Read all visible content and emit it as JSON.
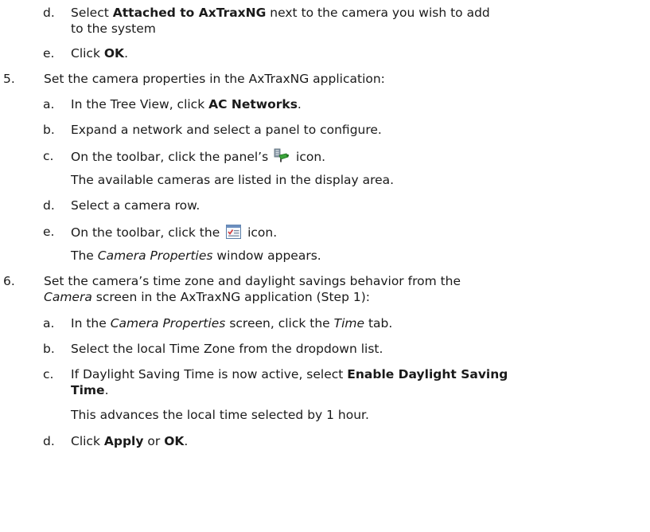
{
  "items": {
    "d1": {
      "label": "d.",
      "pre": "Select ",
      "bold": "Attached to AxTraxNG",
      "post": " next to the camera you wish to add",
      "line2": "to the system"
    },
    "e1": {
      "label": "e.",
      "pre": "Click ",
      "bold": "OK",
      "post": "."
    },
    "s5": {
      "label": "5.",
      "text": "Set the camera properties in the AxTraxNG application:"
    },
    "a5": {
      "label": "a.",
      "pre": "In the Tree View, click ",
      "bold": "AC Networks",
      "post": "."
    },
    "b5": {
      "label": "b.",
      "text": "Expand a network and select a panel to configure."
    },
    "c5": {
      "label": "c.",
      "pre": "On the toolbar, click the panel’s ",
      "post": " icon.",
      "note": "The available cameras are listed in the display area.",
      "icon": "camera-panel-icon"
    },
    "d5": {
      "label": "d.",
      "text": "Select a camera row."
    },
    "e5": {
      "label": "e.",
      "pre": "On the toolbar, click the ",
      "post": " icon.",
      "icon": "properties-icon",
      "note_italic": "Camera Properties",
      "note_post": " window appears.",
      "note_pre": "The "
    },
    "s6": {
      "label": "6.",
      "line1": "Set the camera’s time zone and daylight savings behavior from the",
      "line2_italic": "Camera",
      "line2_post": " screen in the AxTraxNG application (Step 1):"
    },
    "a6": {
      "label": "a.",
      "pre": "In the ",
      "italic1": "Camera Properties",
      "mid": " screen, click the ",
      "italic2": "Time",
      "post": " tab."
    },
    "b6": {
      "label": "b.",
      "text": "Select the local Time Zone from the dropdown list."
    },
    "c6": {
      "label": "c.",
      "pre": "If Daylight Saving Time is now active, select ",
      "bold": "Enable Daylight Saving",
      "bold2": "Time",
      "post": ".",
      "note": "This advances the local time selected by 1 hour."
    },
    "d6": {
      "label": "d.",
      "pre": "Click ",
      "bold1": "Apply",
      "mid": " or ",
      "bold2": "OK",
      "post": "."
    }
  }
}
